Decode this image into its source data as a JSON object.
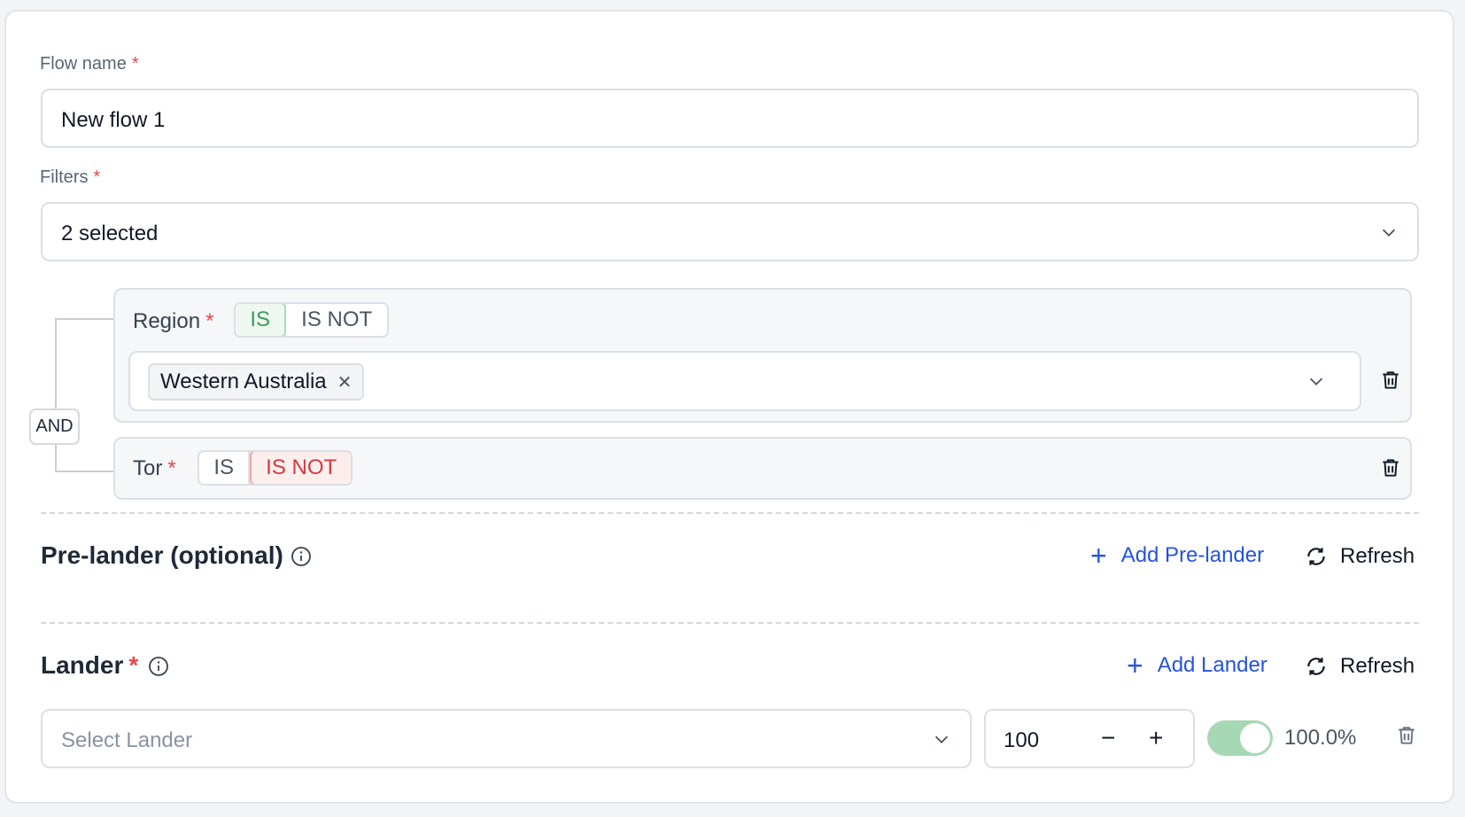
{
  "flow_name": {
    "label": "Flow name",
    "required_mark": "*",
    "value": "New flow 1"
  },
  "filters": {
    "label": "Filters",
    "required_mark": "*",
    "selected_text": "2 selected",
    "combinator": "AND",
    "groups": [
      {
        "name": "Region",
        "required_mark": "*",
        "is_label": "IS",
        "is_not_label": "IS NOT",
        "mode": "IS",
        "chips": [
          "Western Australia"
        ]
      },
      {
        "name": "Tor",
        "required_mark": "*",
        "is_label": "IS",
        "is_not_label": "IS NOT",
        "mode": "IS NOT"
      }
    ]
  },
  "prelander": {
    "title": "Pre-lander (optional)",
    "add_label": "Add Pre-lander",
    "refresh_label": "Refresh"
  },
  "lander": {
    "title": "Lander",
    "required_mark": "*",
    "add_label": "Add Lander",
    "refresh_label": "Refresh",
    "select_placeholder": "Select Lander",
    "weight_value": "100",
    "minus_glyph": "−",
    "plus_glyph": "+",
    "toggle_on": true,
    "percent": "100.0%"
  },
  "colors": {
    "accent": "#2553e0",
    "required": "#e5484d",
    "is_active_green": "#3a9a5c",
    "is_not_active_red": "#d23b3b",
    "toggle_on": "#a6d8b4"
  }
}
